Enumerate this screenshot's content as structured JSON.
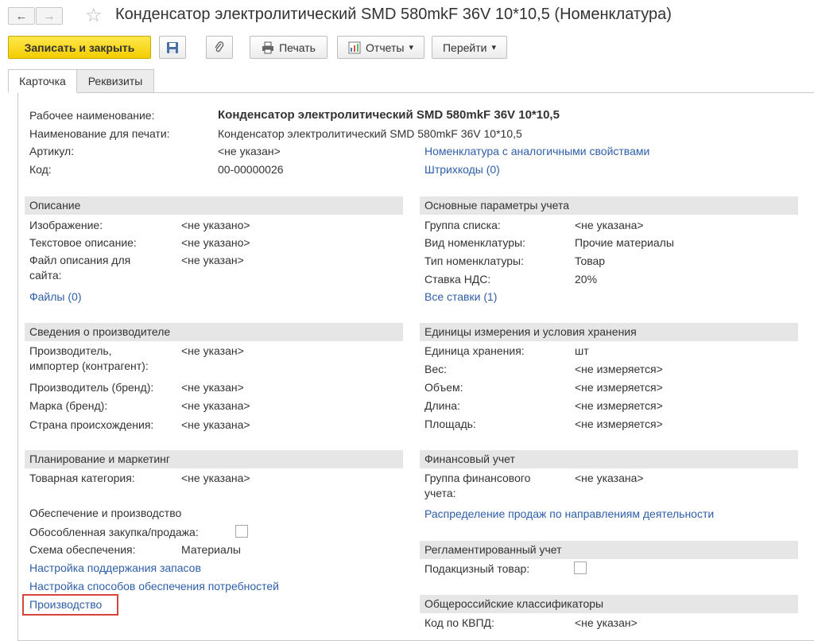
{
  "header": {
    "back_icon": "arrow-left-icon",
    "forward_icon": "arrow-right-icon",
    "star_icon": "star-icon",
    "title": "Конденсатор электролитический SMD 580mkF 36V 10*10,5 (Номенклатура)"
  },
  "toolbar": {
    "save_close_label": "Записать и закрыть",
    "save_icon": "floppy-disk-icon",
    "attach_icon": "paperclip-icon",
    "print_label": "Печать",
    "print_icon": "printer-icon",
    "reports_label": "Отчеты",
    "reports_icon": "report-icon",
    "goto_label": "Перейти",
    "dropdown_arrow": "▾",
    "accent_color": "#f6d313"
  },
  "tabs": [
    {
      "label": "Карточка",
      "active": true
    },
    {
      "label": "Реквизиты",
      "active": false
    }
  ],
  "top": {
    "work_name_label": "Рабочее наименование:",
    "work_name_value": "Конденсатор электролитический SMD 580mkF 36V 10*10,5",
    "print_name_label": "Наименование для печати:",
    "print_name_value": "Конденсатор электролитический SMD 580mkF 36V 10*10,5",
    "article_label": "Артикул:",
    "article_value": "<не указан>",
    "code_label": "Код:",
    "code_value": "00-00000026",
    "similar_link": "Номенклатура с аналогичными свойствами",
    "barcodes_link": "Штрихкоды (0)"
  },
  "left": {
    "description": {
      "title": "Описание",
      "image_label": "Изображение:",
      "image_value": "<не указано>",
      "text_label": "Текстовое описание:",
      "text_value": "<не указано>",
      "file_label_1": "Файл описания для",
      "file_label_2": "сайта:",
      "file_value": "<не указан>",
      "files_link": "Файлы (0)"
    },
    "manufacturer": {
      "title": "Сведения о производителе",
      "producer_label_1": "Производитель,",
      "producer_label_2": "импортер (контрагент):",
      "producer_value": "<не указан>",
      "brand_label": "Производитель (бренд):",
      "brand_value": "<не указан>",
      "mark_label": "Марка (бренд):",
      "mark_value": "<не указана>",
      "country_label": "Страна происхождения:",
      "country_value": "<не указана>"
    },
    "planning": {
      "title": "Планирование и маркетинг",
      "category_label": "Товарная категория:",
      "category_value": "<не указана>"
    },
    "supply": {
      "title": "Обеспечение и производство",
      "separate_label": "Обособленная закупка/продажа:",
      "scheme_label": "Схема обеспечения:",
      "scheme_value": "Материалы",
      "stock_link": "Настройка поддержания запасов",
      "methods_link": "Настройка способов обеспечения потребностей",
      "production_link": "Производство"
    }
  },
  "right": {
    "accounting": {
      "title": "Основные параметры учета",
      "group_label": "Группа списка:",
      "group_value": "<не указана>",
      "kind_label": "Вид номенклатуры:",
      "kind_value": "Прочие материалы",
      "type_label": "Тип номенклатуры:",
      "type_value": "Товар",
      "vat_label": "Ставка НДС:",
      "vat_value": "20%",
      "rates_link": "Все ставки (1)"
    },
    "units": {
      "title": "Единицы измерения и условия хранения",
      "unit_label": "Единица хранения:",
      "unit_value": "шт",
      "weight_label": "Вес:",
      "weight_value": "<не измеряется>",
      "volume_label": "Объем:",
      "volume_value": "<не измеряется>",
      "length_label": "Длина:",
      "length_value": "<не измеряется>",
      "area_label": "Площадь:",
      "area_value": "<не измеряется>"
    },
    "finance": {
      "title": "Финансовый учет",
      "fin_group_label_1": "Группа финансового",
      "fin_group_label_2": "учета:",
      "fin_group_value": "<не указана>",
      "distribution_link": "Распределение продаж по направлениям деятельности"
    },
    "regulated": {
      "title": "Регламентированный учет",
      "excise_label": "Подакцизный товар:"
    },
    "classifiers": {
      "title": "Общероссийские классификаторы",
      "kvpd_label": "Код по КВПД:",
      "kvpd_value": "<не указан>"
    }
  }
}
